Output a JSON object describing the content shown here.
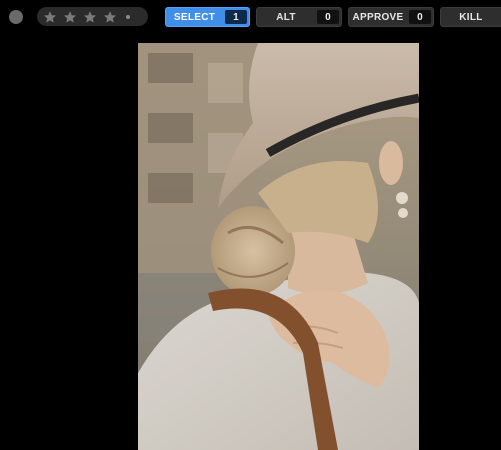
{
  "toolbar": {
    "status_icon": "circle-status-icon",
    "rating": {
      "max_stars": 5,
      "current": 0,
      "star_color": "#7a7a7a",
      "icon": "star-icon"
    },
    "buttons": [
      {
        "label": "SELECT",
        "count": "1",
        "active": true,
        "accent": "#3f8ee8"
      },
      {
        "label": "ALT",
        "count": "0",
        "active": false
      },
      {
        "label": "APPROVE",
        "count": "0",
        "active": false
      },
      {
        "label": "KILL",
        "count": "",
        "active": false
      }
    ]
  },
  "viewer": {
    "image_description_icon": "photo-preview"
  }
}
